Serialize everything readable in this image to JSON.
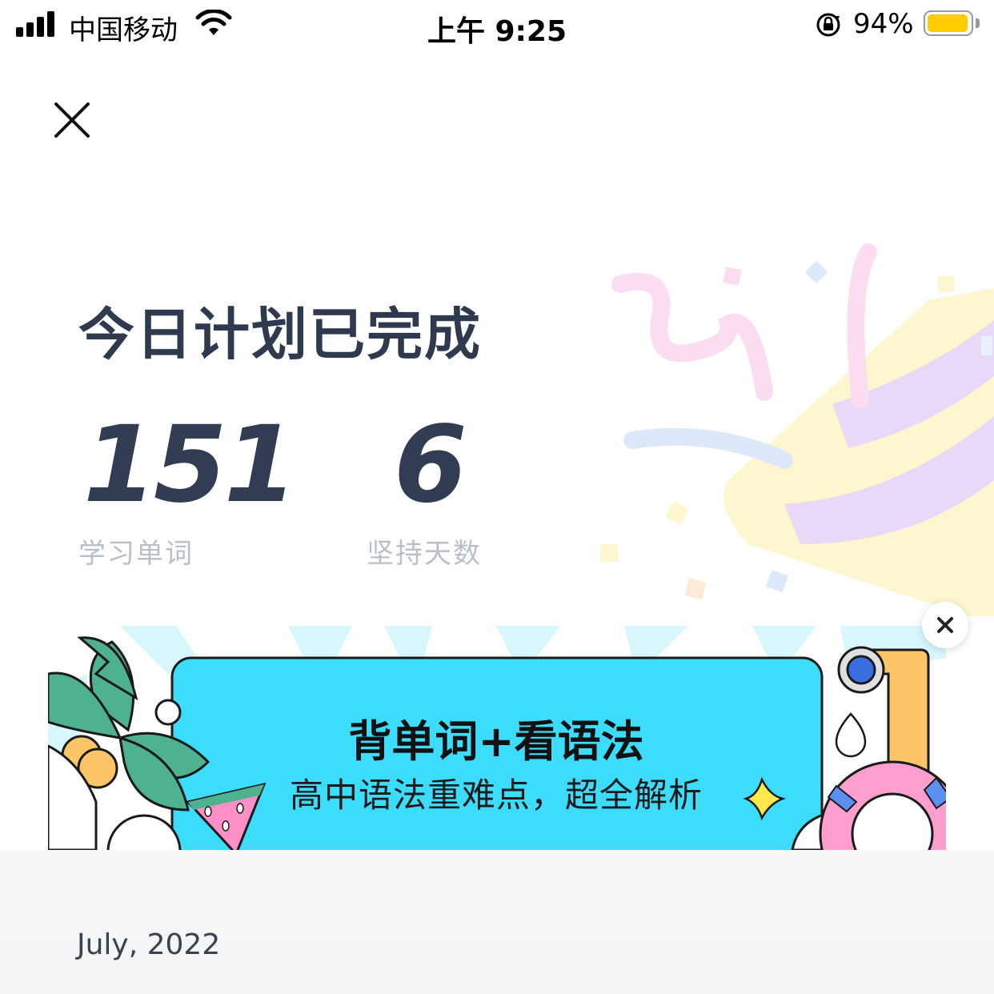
{
  "status_bar": {
    "carrier": "中国移动",
    "time": "上午 9:25",
    "battery_percent": "94%",
    "battery_level": 0.94
  },
  "page": {
    "title": "今日计划已完成"
  },
  "stats": [
    {
      "value": "151",
      "label": "学习单词"
    },
    {
      "value": "6",
      "label": "坚持天数"
    }
  ],
  "banner": {
    "title": "背单词+看语法",
    "subtitle": "高中语法重难点，超全解析"
  },
  "calendar": {
    "month_label": "July, 2022"
  },
  "colors": {
    "banner_bg": "#3cdcfc",
    "battery": "#ffcc00",
    "text_primary": "#2f3a4f",
    "text_secondary": "#b9bfc8"
  }
}
